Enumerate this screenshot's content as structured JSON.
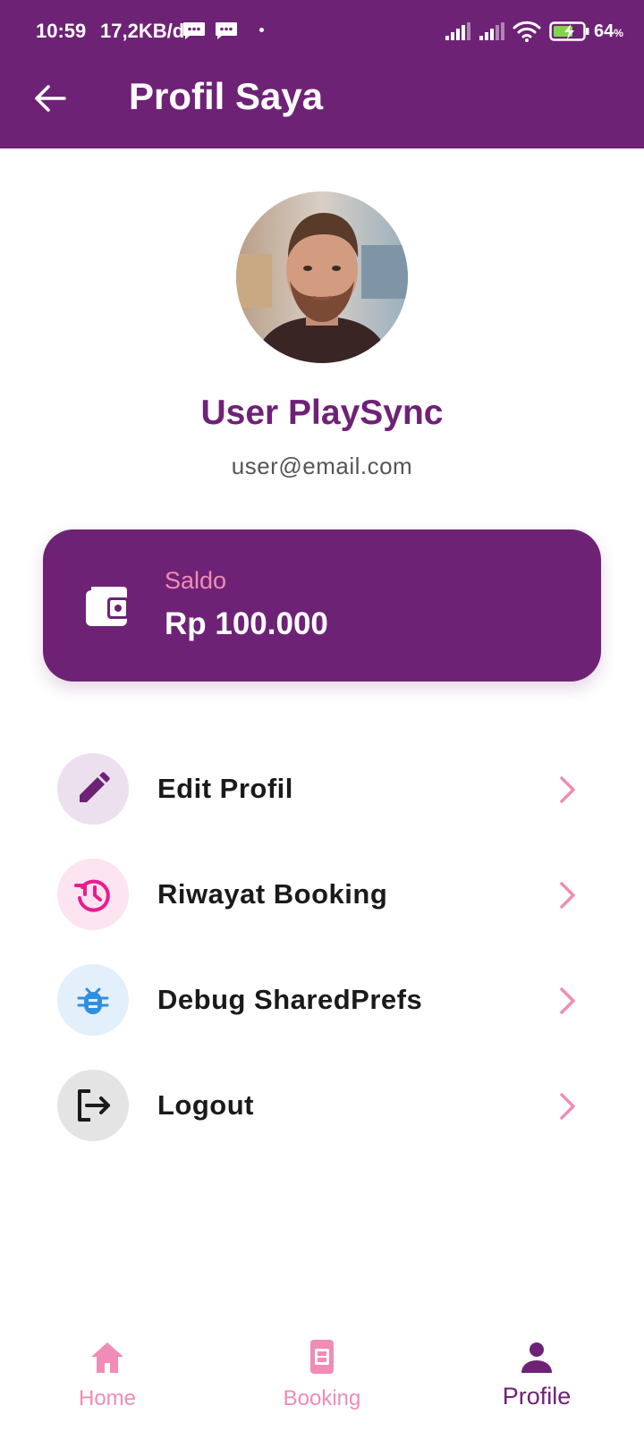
{
  "status_bar": {
    "time": "10:59",
    "speed": "17,2KB/d",
    "battery": "64",
    "battery_unit": "%"
  },
  "header": {
    "title": "Profil Saya",
    "back_icon": "arrow-left-icon"
  },
  "profile": {
    "name": "User PlaySync",
    "email": "user@email.com",
    "avatar_icon": "avatar-photo"
  },
  "balance": {
    "label": "Saldo",
    "amount": "Rp 100.000",
    "icon": "wallet-icon"
  },
  "menu": [
    {
      "label": "Edit Profil",
      "icon": "pencil-icon",
      "icon_color": "#6e2276",
      "bg_color": "#ece0ef"
    },
    {
      "label": "Riwayat Booking",
      "icon": "history-icon",
      "icon_color": "#e91e8c",
      "bg_color": "#fde4f1"
    },
    {
      "label": "Debug SharedPrefs",
      "icon": "bug-icon",
      "icon_color": "#2f8fe0",
      "bg_color": "#e3f0fc"
    },
    {
      "label": "Logout",
      "icon": "logout-icon",
      "icon_color": "#1a1a1a",
      "bg_color": "#e4e4e4"
    }
  ],
  "bottom_nav": [
    {
      "label": "Home",
      "icon": "home-icon",
      "active": false
    },
    {
      "label": "Booking",
      "icon": "ticket-icon",
      "active": false
    },
    {
      "label": "Profile",
      "icon": "person-icon",
      "active": true
    }
  ],
  "colors": {
    "primary": "#6e2276",
    "accent_pink": "#f08cb5"
  }
}
